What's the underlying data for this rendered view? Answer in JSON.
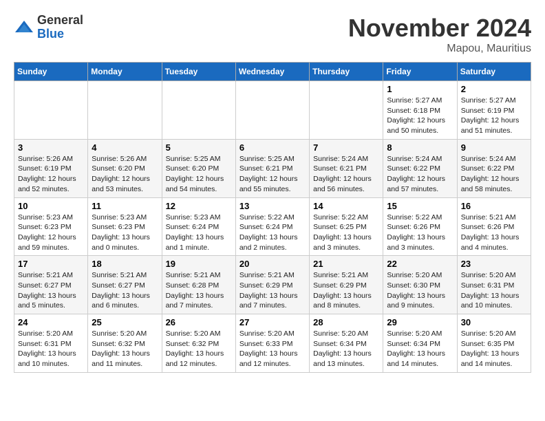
{
  "logo": {
    "general": "General",
    "blue": "Blue"
  },
  "header": {
    "month": "November 2024",
    "location": "Mapou, Mauritius"
  },
  "days_of_week": [
    "Sunday",
    "Monday",
    "Tuesday",
    "Wednesday",
    "Thursday",
    "Friday",
    "Saturday"
  ],
  "weeks": [
    [
      {
        "day": "",
        "info": ""
      },
      {
        "day": "",
        "info": ""
      },
      {
        "day": "",
        "info": ""
      },
      {
        "day": "",
        "info": ""
      },
      {
        "day": "",
        "info": ""
      },
      {
        "day": "1",
        "info": "Sunrise: 5:27 AM\nSunset: 6:18 PM\nDaylight: 12 hours and 50 minutes."
      },
      {
        "day": "2",
        "info": "Sunrise: 5:27 AM\nSunset: 6:19 PM\nDaylight: 12 hours and 51 minutes."
      }
    ],
    [
      {
        "day": "3",
        "info": "Sunrise: 5:26 AM\nSunset: 6:19 PM\nDaylight: 12 hours and 52 minutes."
      },
      {
        "day": "4",
        "info": "Sunrise: 5:26 AM\nSunset: 6:20 PM\nDaylight: 12 hours and 53 minutes."
      },
      {
        "day": "5",
        "info": "Sunrise: 5:25 AM\nSunset: 6:20 PM\nDaylight: 12 hours and 54 minutes."
      },
      {
        "day": "6",
        "info": "Sunrise: 5:25 AM\nSunset: 6:21 PM\nDaylight: 12 hours and 55 minutes."
      },
      {
        "day": "7",
        "info": "Sunrise: 5:24 AM\nSunset: 6:21 PM\nDaylight: 12 hours and 56 minutes."
      },
      {
        "day": "8",
        "info": "Sunrise: 5:24 AM\nSunset: 6:22 PM\nDaylight: 12 hours and 57 minutes."
      },
      {
        "day": "9",
        "info": "Sunrise: 5:24 AM\nSunset: 6:22 PM\nDaylight: 12 hours and 58 minutes."
      }
    ],
    [
      {
        "day": "10",
        "info": "Sunrise: 5:23 AM\nSunset: 6:23 PM\nDaylight: 12 hours and 59 minutes."
      },
      {
        "day": "11",
        "info": "Sunrise: 5:23 AM\nSunset: 6:23 PM\nDaylight: 13 hours and 0 minutes."
      },
      {
        "day": "12",
        "info": "Sunrise: 5:23 AM\nSunset: 6:24 PM\nDaylight: 13 hours and 1 minute."
      },
      {
        "day": "13",
        "info": "Sunrise: 5:22 AM\nSunset: 6:24 PM\nDaylight: 13 hours and 2 minutes."
      },
      {
        "day": "14",
        "info": "Sunrise: 5:22 AM\nSunset: 6:25 PM\nDaylight: 13 hours and 3 minutes."
      },
      {
        "day": "15",
        "info": "Sunrise: 5:22 AM\nSunset: 6:26 PM\nDaylight: 13 hours and 3 minutes."
      },
      {
        "day": "16",
        "info": "Sunrise: 5:21 AM\nSunset: 6:26 PM\nDaylight: 13 hours and 4 minutes."
      }
    ],
    [
      {
        "day": "17",
        "info": "Sunrise: 5:21 AM\nSunset: 6:27 PM\nDaylight: 13 hours and 5 minutes."
      },
      {
        "day": "18",
        "info": "Sunrise: 5:21 AM\nSunset: 6:27 PM\nDaylight: 13 hours and 6 minutes."
      },
      {
        "day": "19",
        "info": "Sunrise: 5:21 AM\nSunset: 6:28 PM\nDaylight: 13 hours and 7 minutes."
      },
      {
        "day": "20",
        "info": "Sunrise: 5:21 AM\nSunset: 6:29 PM\nDaylight: 13 hours and 7 minutes."
      },
      {
        "day": "21",
        "info": "Sunrise: 5:21 AM\nSunset: 6:29 PM\nDaylight: 13 hours and 8 minutes."
      },
      {
        "day": "22",
        "info": "Sunrise: 5:20 AM\nSunset: 6:30 PM\nDaylight: 13 hours and 9 minutes."
      },
      {
        "day": "23",
        "info": "Sunrise: 5:20 AM\nSunset: 6:31 PM\nDaylight: 13 hours and 10 minutes."
      }
    ],
    [
      {
        "day": "24",
        "info": "Sunrise: 5:20 AM\nSunset: 6:31 PM\nDaylight: 13 hours and 10 minutes."
      },
      {
        "day": "25",
        "info": "Sunrise: 5:20 AM\nSunset: 6:32 PM\nDaylight: 13 hours and 11 minutes."
      },
      {
        "day": "26",
        "info": "Sunrise: 5:20 AM\nSunset: 6:32 PM\nDaylight: 13 hours and 12 minutes."
      },
      {
        "day": "27",
        "info": "Sunrise: 5:20 AM\nSunset: 6:33 PM\nDaylight: 13 hours and 12 minutes."
      },
      {
        "day": "28",
        "info": "Sunrise: 5:20 AM\nSunset: 6:34 PM\nDaylight: 13 hours and 13 minutes."
      },
      {
        "day": "29",
        "info": "Sunrise: 5:20 AM\nSunset: 6:34 PM\nDaylight: 13 hours and 14 minutes."
      },
      {
        "day": "30",
        "info": "Sunrise: 5:20 AM\nSunset: 6:35 PM\nDaylight: 13 hours and 14 minutes."
      }
    ]
  ]
}
